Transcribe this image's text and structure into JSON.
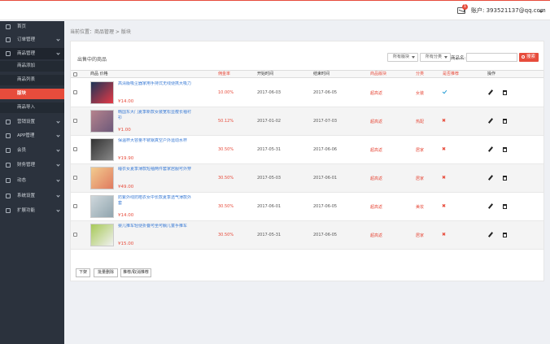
{
  "topbar": {
    "mail_badge": "1",
    "account_label": "账户:",
    "account_value": "393521137@qq.com"
  },
  "sidebar": {
    "items": [
      {
        "label": "首页",
        "icon": "home-icon"
      },
      {
        "label": "订单管理",
        "icon": "list-icon"
      },
      {
        "label": "商品管理",
        "icon": "box-icon"
      },
      {
        "label": "营销设置",
        "icon": "tag-icon"
      },
      {
        "label": "APP管理",
        "icon": "phone-icon"
      },
      {
        "label": "会员",
        "icon": "user-icon"
      },
      {
        "label": "财务管理",
        "icon": "money-icon"
      },
      {
        "label": "动态",
        "icon": "chat-icon"
      },
      {
        "label": "系统设置",
        "icon": "gear-icon"
      },
      {
        "label": "扩展功能",
        "icon": "puzzle-icon"
      }
    ],
    "subitems": [
      "商品添加",
      "商品列表",
      "版块",
      "商品导入"
    ]
  },
  "breadcrumb": "当前位置：商品管理 > 版块",
  "panel": {
    "title": "出售中的商品",
    "filter1": "所有版块",
    "filter2": "所有分类",
    "name_label": "商品名:",
    "search_label": "搜索"
  },
  "table": {
    "headers": [
      "商品 价格",
      "佣金率",
      "开始时间",
      "结束时间",
      "商品版块",
      "分类",
      "是否推荐",
      "操作"
    ],
    "rows": [
      {
        "name": "高清版吸尘器家用手持式无线便携大吸力",
        "price": "¥14.00",
        "rate": "10.00%",
        "start": "2017-06-03",
        "end": "2017-06-05",
        "section": "超高返",
        "category": "女装",
        "recommended": true
      },
      {
        "name": "韩国东大门夏季新款女装宽松显瘦长袖衬衫",
        "price": "¥1.00",
        "rate": "50.12%",
        "start": "2017-01-02",
        "end": "2017-07-03",
        "section": "超高返",
        "category": "热配",
        "recommended": false
      },
      {
        "name": "保温杯大容量不锈钢真空户外运动水杯",
        "price": "¥19.90",
        "rate": "30.50%",
        "start": "2017-05-31",
        "end": "2017-06-06",
        "section": "超高返",
        "category": "居家",
        "recommended": false
      },
      {
        "name": "睡衣女夏季薄款短袖两件套家居服可外穿",
        "price": "¥49.00",
        "rate": "30.50%",
        "start": "2017-05-03",
        "end": "2017-06-01",
        "section": "超高返",
        "category": "居家",
        "recommended": false
      },
      {
        "name": "防紫外线防晒衣女中长款夏季透气薄款外套",
        "price": "¥14.00",
        "rate": "30.50%",
        "start": "2017-06-01",
        "end": "2017-06-05",
        "section": "超高返",
        "category": "美妆",
        "recommended": false
      },
      {
        "name": "婴儿推车轻便折叠可坐可躺儿童手推车",
        "price": "¥15.00",
        "rate": "30.50%",
        "start": "2017-05-31",
        "end": "2017-06-05",
        "section": "超高返",
        "category": "居家",
        "recommended": false
      }
    ]
  },
  "footer_buttons": [
    "下架",
    "批量删除",
    "推荐/取消推荐"
  ]
}
